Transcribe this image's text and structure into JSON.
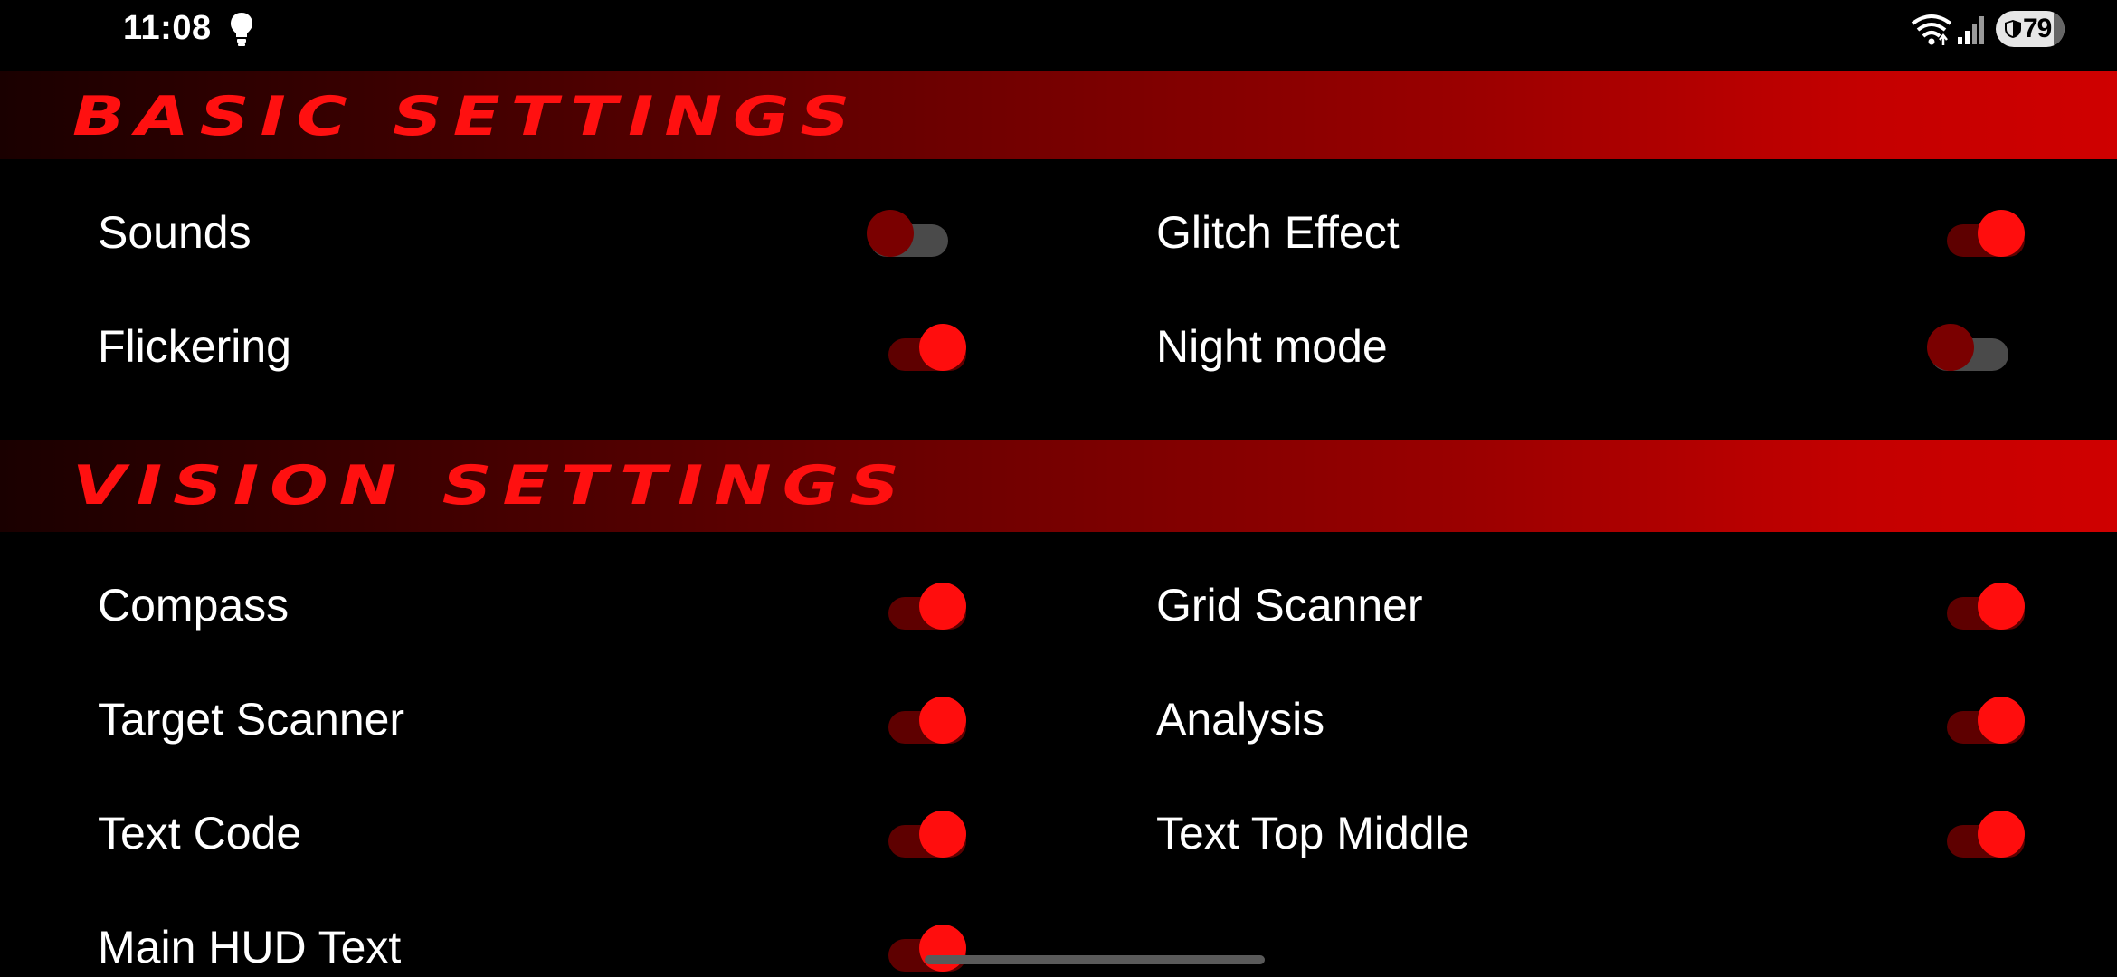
{
  "status_bar": {
    "time": "11:08",
    "battery_percent": "79",
    "icons": [
      "lightbulb-icon",
      "wifi-icon",
      "signal-icon",
      "battery-icon"
    ]
  },
  "sections": {
    "basic": {
      "title": "BASIC SETTINGS",
      "settings": [
        {
          "label": "Sounds",
          "on": false
        },
        {
          "label": "Glitch Effect",
          "on": true
        },
        {
          "label": "Flickering",
          "on": true
        },
        {
          "label": "Night mode",
          "on": false
        }
      ]
    },
    "vision": {
      "title": "VISION SETTINGS",
      "settings": [
        {
          "label": "Compass",
          "on": true
        },
        {
          "label": "Grid Scanner",
          "on": true
        },
        {
          "label": "Target Scanner",
          "on": true
        },
        {
          "label": "Analysis",
          "on": true
        },
        {
          "label": "Text Code",
          "on": true
        },
        {
          "label": "Text Top Middle",
          "on": true
        },
        {
          "label": "Main HUD Text",
          "on": true
        }
      ]
    }
  },
  "colors": {
    "accent": "#ff0d0d",
    "banner_dark": "#1a0000",
    "banner_light": "#cf0000",
    "background": "#000000"
  }
}
